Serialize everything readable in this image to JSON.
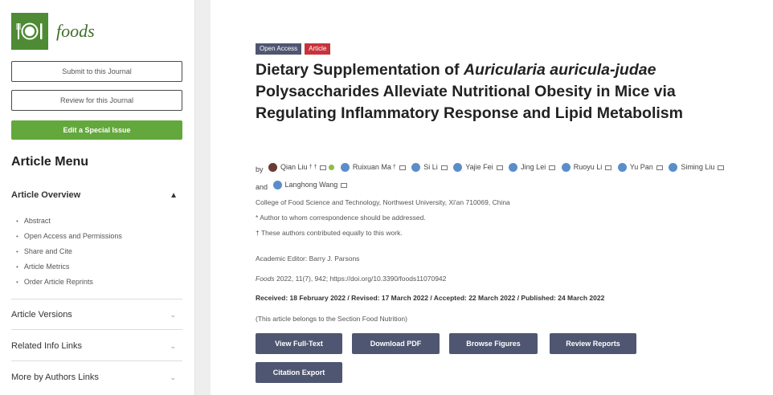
{
  "journal": {
    "logo_text": "foods",
    "logo_icon": "plate-fork-knife-icon"
  },
  "sidebar": {
    "submit_label": "Submit to this Journal",
    "review_label": "Review for this Journal",
    "edit_label": "Edit a Special Issue",
    "menu_title": "Article Menu",
    "overview_label": "Article Overview",
    "overview_items": [
      "Abstract",
      "Open Access and Permissions",
      "Share and Cite",
      "Article Metrics",
      "Order Article Reprints"
    ],
    "versions_label": "Article Versions",
    "related_label": "Related Info Links",
    "more_authors_label": "More by Authors Links"
  },
  "article": {
    "badge_open": "Open Access",
    "badge_type": "Article",
    "title_pre": "Dietary Supplementation of ",
    "title_italic": "Auricularia auricula-judae",
    "title_post": " Polysaccharides Alleviate Nutritional Obesity in Mice via Regulating Inflammatory Response and Lipid Metabolism",
    "by": "by",
    "authors": [
      "Qian Liu",
      "Ruixuan Ma",
      "Si Li",
      "Yajie Fei",
      "Jing Lei",
      "Ruoyu Li",
      "Yu Pan",
      "Siming Liu"
    ],
    "and": "and",
    "last_author": "Langhong Wang",
    "first_author_sup": "† †",
    "second_author_sup": "†",
    "affiliation": "College of Food Science and Technology, Northwest University, Xi'an 710069, China",
    "corr_note": "Author to whom correspondence should be addressed.",
    "equal_note": "These authors contributed equally to this work.",
    "note_marker_star": "*",
    "note_marker_dagger": "†",
    "editor": "Academic Editor: Barry J. Parsons",
    "citation_journal": "Foods",
    "citation_rest": " 2022, 11(7), 942; https://doi.org/10.3390/foods11070942",
    "dates": "Received: 18 February 2022 / Revised: 17 March 2022 / Accepted: 22 March 2022 / Published: 24 March 2022",
    "section_note": "(This article belongs to the Section Food Nutrition)"
  },
  "actions": {
    "view_full_text": "View Full-Text",
    "download_pdf": "Download PDF",
    "browse_figures": "Browse Figures",
    "review_reports": "Review Reports",
    "citation_export": "Citation Export"
  },
  "colors": {
    "brand_green": "#4e8b34",
    "button_dark": "#4f5671",
    "badge_red": "#c8323b"
  }
}
